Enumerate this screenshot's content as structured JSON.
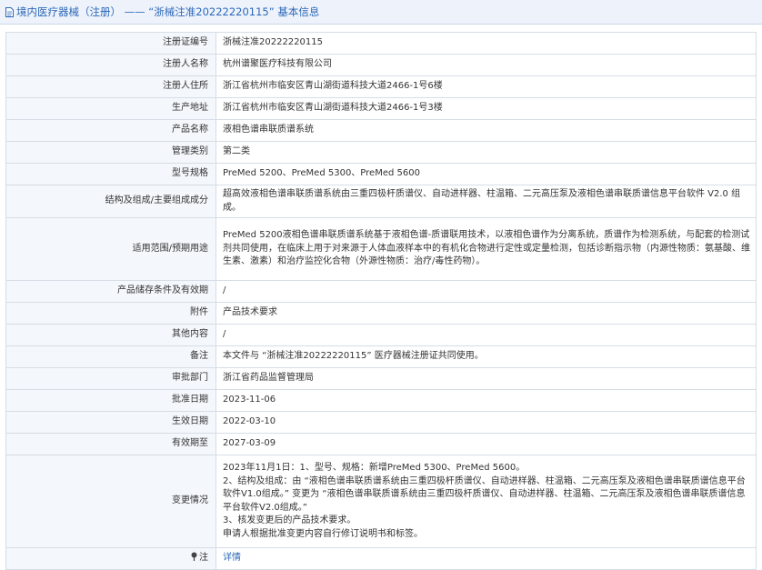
{
  "header": {
    "title": "境内医疗器械（注册） —— “浙械注准20222220115” 基本信息"
  },
  "rows": [
    {
      "label": "注册证编号",
      "value": "浙械注准20222220115"
    },
    {
      "label": "注册人名称",
      "value": "杭州谱聚医疗科技有限公司"
    },
    {
      "label": "注册人住所",
      "value": "浙江省杭州市临安区青山湖街道科技大道2466-1号6楼"
    },
    {
      "label": "生产地址",
      "value": "浙江省杭州市临安区青山湖街道科技大道2466-1号3楼"
    },
    {
      "label": "产品名称",
      "value": "液相色谱串联质谱系统"
    },
    {
      "label": "管理类别",
      "value": "第二类"
    },
    {
      "label": "型号规格",
      "value": "PreMed 5200、PreMed 5300、PreMed 5600"
    },
    {
      "label": "结构及组成/主要组成成分",
      "value": "超高效液相色谱串联质谱系统由三重四极杆质谱仪、自动进样器、柱温箱、二元高压泵及液相色谱串联质谱信息平台软件 V2.0 组成。"
    },
    {
      "label": "适用范围/预期用途",
      "value": "PreMed 5200液相色谱串联质谱系统基于液相色谱-质谱联用技术，以液相色谱作为分离系统，质谱作为检测系统，与配套的检测试剂共同使用，在临床上用于对来源于人体血液样本中的有机化合物进行定性或定量检测，包括诊断指示物（内源性物质：氨基酸、维生素、激素）和治疗监控化合物（外源性物质：治疗/毒性药物）。"
    },
    {
      "label": "产品储存条件及有效期",
      "value": "/"
    },
    {
      "label": "附件",
      "value": "产品技术要求"
    },
    {
      "label": "其他内容",
      "value": "/"
    },
    {
      "label": "备注",
      "value": "本文件与 “浙械注准20222220115” 医疗器械注册证共同使用。"
    },
    {
      "label": "审批部门",
      "value": "浙江省药品监督管理局"
    },
    {
      "label": "批准日期",
      "value": "2023-11-06"
    },
    {
      "label": "生效日期",
      "value": "2022-03-10"
    },
    {
      "label": "有效期至",
      "value": "2027-03-09"
    }
  ],
  "changes": {
    "label": "变更情况",
    "lines": [
      "2023年11月1日：1、型号、规格：新增PreMed 5300、PreMed 5600。",
      "2、结构及组成：由 “液相色谱串联质谱系统由三重四极杆质谱仪、自动进样器、柱温箱、二元高压泵及液相色谱串联质谱信息平台软件V1.0组成。” 变更为 “液相色谱串联质谱系统由三重四极杆质谱仪、自动进样器、柱温箱、二元高压泵及液相色谱串联质谱信息平台软件V2.0组成。”",
      "3、核发变更后的产品技术要求。",
      "申请人根据批准变更内容自行修订说明书和标签。"
    ]
  },
  "note": {
    "label": "注",
    "icon": "pin-icon",
    "link": "详情"
  }
}
